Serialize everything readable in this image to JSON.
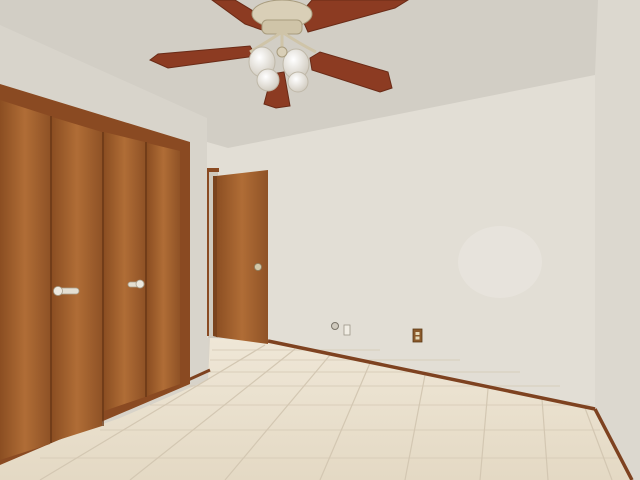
{
  "scene": {
    "subject": "empty-bedroom",
    "colors": {
      "ceiling": "#d6d2c9",
      "wall_back": "#e3dfd6",
      "wall_left": "#d9d5cc",
      "wall_right": "#dedad1",
      "floor_tile": "#e9e0cf",
      "grout": "#cfc4b0",
      "wood": "#a25f2e",
      "wood_dark": "#7a431d",
      "trim": "#8a4a22",
      "fan_blade": "#8c3b22",
      "fan_metal": "#d7cdb5",
      "glass": "#f4f2ee",
      "handle": "#e2dccf"
    },
    "objects": [
      "ceiling-fan",
      "bifold-closet-doors",
      "open-interior-door",
      "floor-tiles",
      "baseboards",
      "wall-outlets"
    ]
  }
}
